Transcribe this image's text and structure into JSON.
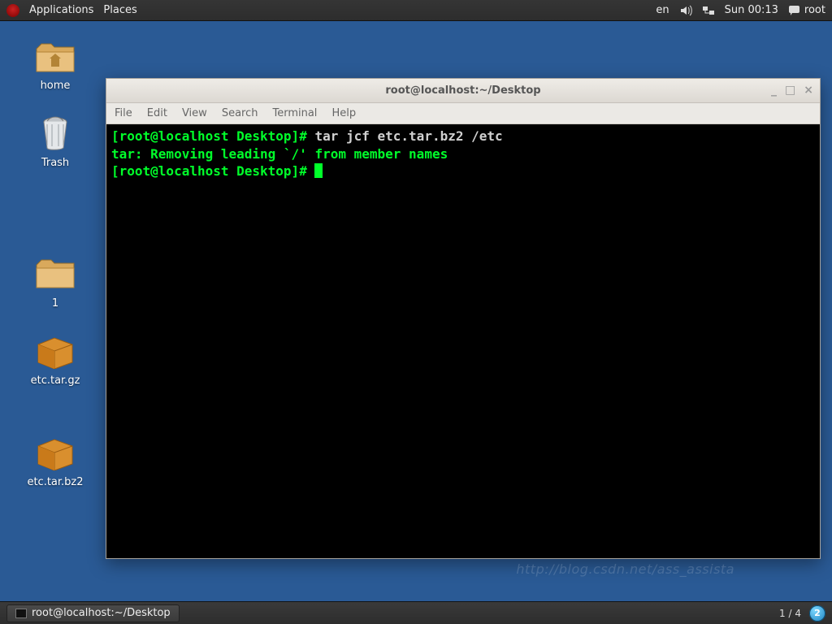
{
  "top_panel": {
    "applications": "Applications",
    "places": "Places",
    "lang": "en",
    "clock": "Sun 00:13",
    "user": "root"
  },
  "desktop_icons": {
    "home": "home",
    "trash": "Trash",
    "folder1": "1",
    "archive1": "etc.tar.gz",
    "archive2": "etc.tar.bz2"
  },
  "terminal": {
    "title": "root@localhost:~/Desktop",
    "menus": {
      "file": "File",
      "edit": "Edit",
      "view": "View",
      "search": "Search",
      "terminal": "Terminal",
      "help": "Help"
    },
    "win_buttons": {
      "min": "_",
      "max": "□",
      "close": "×"
    },
    "lines": {
      "prompt1": "[root@localhost Desktop]# ",
      "cmd1": "tar jcf etc.tar.bz2 /etc",
      "msg": "tar: Removing leading `/' from member names",
      "prompt2": "[root@localhost Desktop]# "
    }
  },
  "bottom_panel": {
    "task": "root@localhost:~/Desktop",
    "workspace": "1 / 4",
    "badge": "2"
  },
  "watermark": "http://blog.csdn.net/ass_assista"
}
